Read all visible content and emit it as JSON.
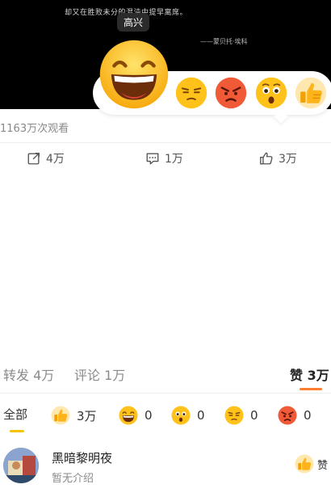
{
  "video": {
    "quote": "却又在胜败未分的混沌中提早离席。",
    "author": "——蒙贝托·埃科",
    "tooltip": "高兴"
  },
  "reaction_picker": {
    "options": [
      "happy-face",
      "unamused-face",
      "angry-face",
      "surprised-face",
      "thumbs-up"
    ]
  },
  "post": {
    "views": "1163万次观看"
  },
  "actions": {
    "repost": "4万",
    "comment": "1万",
    "like": "3万"
  },
  "tabs": {
    "repost": "转发 4万",
    "comment": "评论 1万",
    "like": "赞 3万"
  },
  "filters": {
    "all": "全部",
    "thumbs": "3万",
    "happy": "0",
    "surprised": "0",
    "unamused": "0",
    "angry": "0"
  },
  "user": {
    "name": "黑暗黎明夜",
    "desc": "暂无介绍",
    "like_label": "赞"
  },
  "colors": {
    "accent": "#ff7e2f",
    "emoji_yellow": "#ffc21a",
    "angry_red": "#f05a36",
    "all_underline": "#f5c400"
  }
}
